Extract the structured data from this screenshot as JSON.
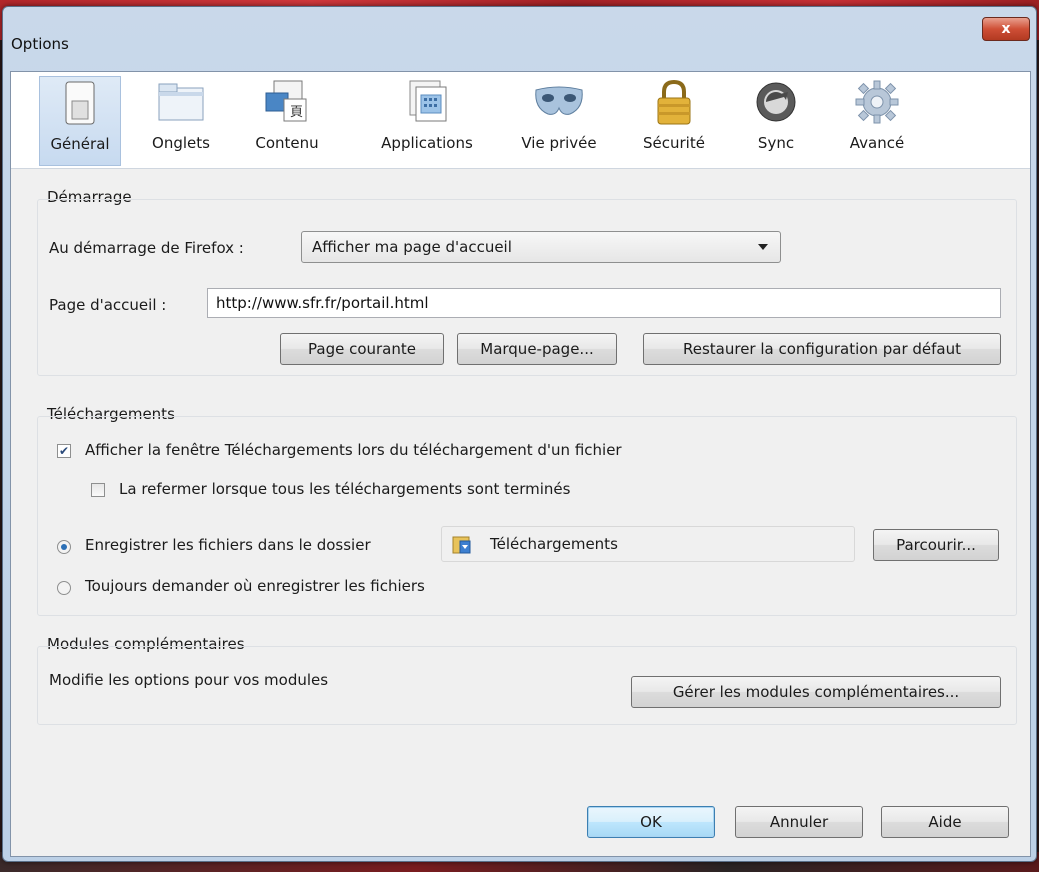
{
  "window": {
    "title": "Options",
    "close_label": "x"
  },
  "toolbar": {
    "tabs": [
      {
        "label": "Général",
        "icon": "general-icon",
        "selected": true
      },
      {
        "label": "Onglets",
        "icon": "tabs-icon",
        "selected": false
      },
      {
        "label": "Contenu",
        "icon": "content-icon",
        "selected": false
      },
      {
        "label": "Applications",
        "icon": "applications-icon",
        "selected": false
      },
      {
        "label": "Vie privée",
        "icon": "privacy-mask-icon",
        "selected": false
      },
      {
        "label": "Sécurité",
        "icon": "lock-icon",
        "selected": false
      },
      {
        "label": "Sync",
        "icon": "sync-icon",
        "selected": false
      },
      {
        "label": "Avancé",
        "icon": "gear-icon",
        "selected": false
      }
    ]
  },
  "startup": {
    "section_title": "Démarrage",
    "when_start_label": "Au démarrage de Firefox :",
    "when_start_value": "Afficher ma page d'accueil",
    "homepage_label": "Page d'accueil :",
    "homepage_value": "http://www.sfr.fr/portail.html",
    "btn_current_page": "Page courante",
    "btn_bookmark": "Marque-page...",
    "btn_restore_default": "Restaurer la configuration par défaut"
  },
  "downloads": {
    "section_title": "Téléchargements",
    "show_window_label": "Afficher la fenêtre Téléchargements lors du téléchargement d'un fichier",
    "show_window_checked": true,
    "close_when_done_label": "La refermer lorsque tous les téléchargements sont terminés",
    "close_when_done_checked": false,
    "save_to_label": "Enregistrer les fichiers dans le dossier",
    "save_to_folder": "Téléchargements",
    "browse_button": "Parcourir...",
    "always_ask_label": "Toujours demander où enregistrer les fichiers",
    "selected_option": "save_to"
  },
  "addons": {
    "section_title": "Modules complémentaires",
    "description": "Modifie les options pour vos modules",
    "manage_button": "Gérer les modules complémentaires..."
  },
  "footer": {
    "ok": "OK",
    "cancel": "Annuler",
    "help": "Aide"
  },
  "colors": {
    "accent": "#2b6fb6",
    "selected_tab_bg": "#c7daf0",
    "close_button": "#cf4f36"
  }
}
